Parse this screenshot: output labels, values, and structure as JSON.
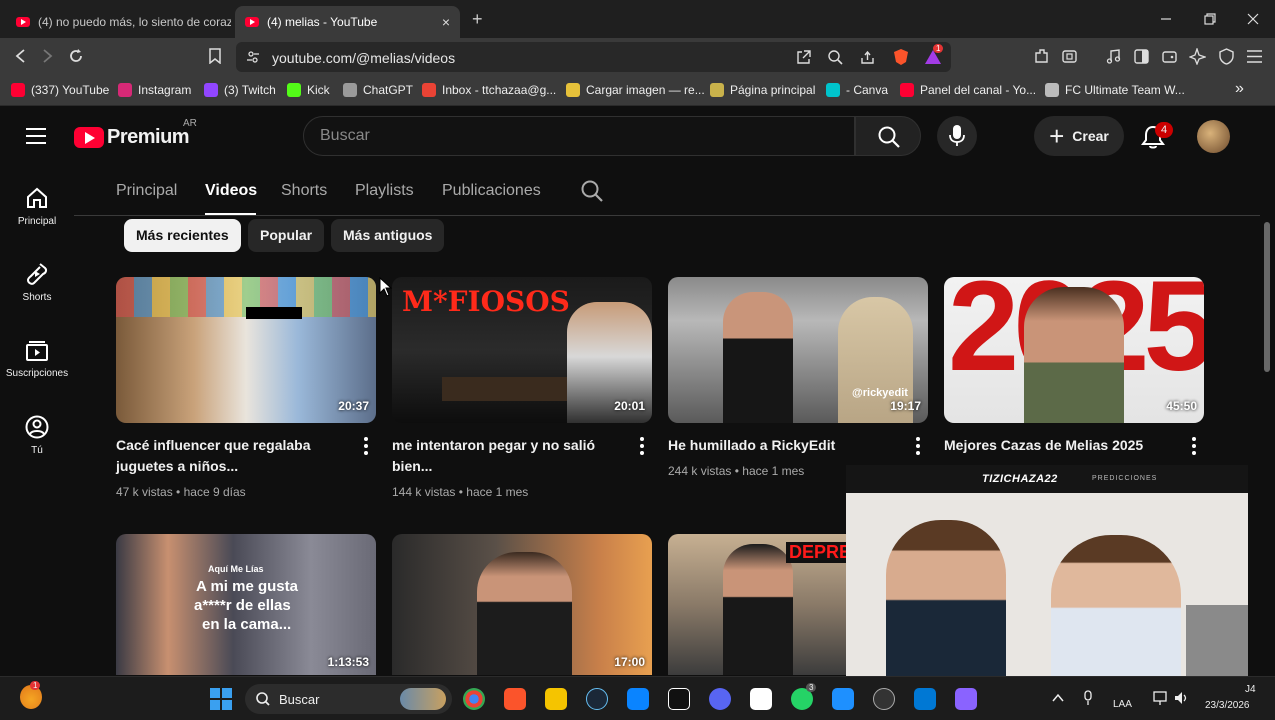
{
  "browser": {
    "tabs": [
      {
        "title": "(4) no puedo más, lo siento de coraz"
      },
      {
        "title": "(4) melias - YouTube"
      }
    ],
    "tab_close_glyph": "×",
    "new_tab_glyph": "+",
    "url": "youtube.com/@melias/videos",
    "shields_badge": "1",
    "bookmarks": [
      {
        "label": "(337) YouTube",
        "color": "#ff0033"
      },
      {
        "label": "Instagram",
        "color": "#d62976"
      },
      {
        "label": "(3) Twitch",
        "color": "#9146ff"
      },
      {
        "label": "Kick",
        "color": "#53fc18"
      },
      {
        "label": "ChatGPT",
        "color": "#9a9a9a"
      },
      {
        "label": "Inbox - ttchazaa@g...",
        "color": "#ea4335"
      },
      {
        "label": "Cargar imagen — re...",
        "color": "#e6c13a"
      },
      {
        "label": "Página principal",
        "color": "#c9b24b"
      },
      {
        "label": "- Canva",
        "color": "#00c4cc"
      },
      {
        "label": "Panel del canal - Yo...",
        "color": "#ff0033"
      },
      {
        "label": "FC Ultimate Team W...",
        "color": "#bbbbbb"
      }
    ],
    "bookmarks_more": "»"
  },
  "youtube": {
    "logo_text": "Premium",
    "country": "AR",
    "search_placeholder": "Buscar",
    "create_label": "Crear",
    "notifications_count": "4",
    "guide": [
      {
        "label": "Principal",
        "icon": "home-icon"
      },
      {
        "label": "Shorts",
        "icon": "shorts-icon"
      },
      {
        "label": "Suscripciones",
        "icon": "subscriptions-icon"
      },
      {
        "label": "Tú",
        "icon": "you-icon"
      }
    ],
    "channel_tabs": [
      "Principal",
      "Videos",
      "Shorts",
      "Playlists",
      "Publicaciones"
    ],
    "active_channel_tab": "Videos",
    "chips": [
      "Más recientes",
      "Popular",
      "Más antiguos"
    ],
    "active_chip": "Más recientes",
    "videos": [
      {
        "title": "Cacé influencer que regalaba juguetes a niños...",
        "views": "47 k vistas",
        "age": "hace 9 días",
        "duration": "20:37"
      },
      {
        "title": "me intentaron pegar y no salió bien...",
        "views": "144 k vistas",
        "age": "hace 1 mes",
        "duration": "20:01",
        "thumb_text": "M*FIOSOS"
      },
      {
        "title": "He humillado a RickyEdit",
        "views": "244 k vistas",
        "age": "hace 1 mes",
        "duration": "19:17",
        "thumb_text": "@rickyedit"
      },
      {
        "title": "Mejores Cazas de Melias 2025",
        "views": "",
        "age": "",
        "duration": "45:50",
        "thumb_text": "2025"
      },
      {
        "title": "",
        "duration": "1:13:53",
        "thumb_text_lines": [
          "Aquí Me Lías",
          "A mi me gusta",
          "a****r de ellas",
          "en la cama..."
        ]
      },
      {
        "title": "",
        "duration": "17:00"
      },
      {
        "title": "",
        "duration": "",
        "thumb_text": "DEPRE"
      }
    ],
    "meta_separator": "•"
  },
  "overlay": {
    "streamer_name": "TIZICHAZA22",
    "tag": "PREDICCIONES"
  },
  "taskbar": {
    "search_label": "Buscar",
    "language": "LAA",
    "date": "23/3/2026",
    "time_fragment": "J4",
    "whatsapp_badge": "3",
    "app_badge": "1",
    "colors": [
      "#0078d4",
      "#4285f4",
      "#fb542b",
      "#f5c400",
      "#1b2838",
      "#0a84ff",
      "#ffffff",
      "#5865f2",
      "#ffffff",
      "#25d366",
      "#1e90ff",
      "#d44b4b",
      "#0078d4",
      "#8a63ff"
    ]
  }
}
